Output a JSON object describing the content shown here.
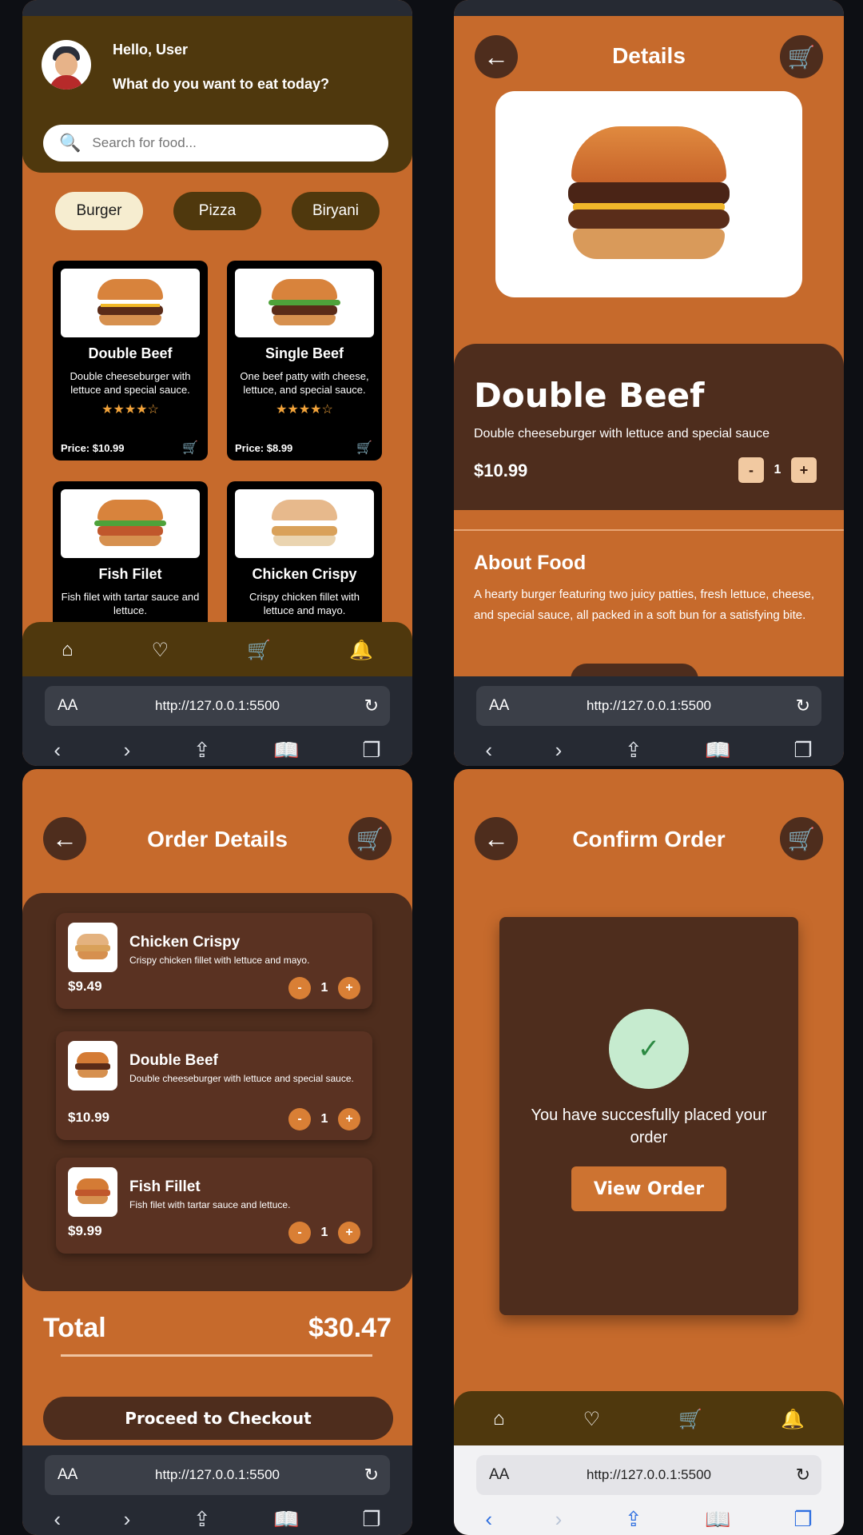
{
  "browser": {
    "aa": "AA",
    "url": "http://127.0.0.1:5500",
    "reload_icon": "↻"
  },
  "nav_icons": {
    "home": "⌂",
    "heart": "♡",
    "cart": "🛒",
    "bell": "🔔"
  },
  "browser_nav_icons": {
    "back": "‹",
    "forward": "›",
    "share": "⇪",
    "bookmarks": "📖",
    "tabs": "❐"
  },
  "screen1": {
    "greeting": "Hello, User",
    "question": "What do you want to eat today?",
    "search_placeholder": "Search for food...",
    "categories": [
      "Burger",
      "Pizza",
      "Biryani"
    ],
    "active_category": "Burger",
    "foods": [
      {
        "name": "Double Beef",
        "desc": "Double cheeseburger with lettuce and special sauce.",
        "stars": "★★★★☆",
        "price": "Price: $10.99"
      },
      {
        "name": "Single Beef",
        "desc": "One beef patty with cheese, lettuce, and special sauce.",
        "stars": "★★★★☆",
        "price": "Price: $8.99"
      },
      {
        "name": "Fish Filet",
        "desc": "Fish filet with tartar sauce and lettuce.",
        "stars": "",
        "price": ""
      },
      {
        "name": "Chicken Crispy",
        "desc": "Crispy chicken fillet with lettuce and mayo.",
        "stars": "",
        "price": ""
      }
    ]
  },
  "screen2": {
    "title": "Details",
    "food_name": "Double Beef",
    "food_desc": "Double cheeseburger with lettuce and special sauce",
    "price": "$10.99",
    "qty": "1",
    "minus": "-",
    "plus": "+",
    "about_title": "About Food",
    "about_text": "A hearty burger featuring two juicy patties, fresh lettuce, cheese, and special sauce, all packed in a soft bun for a satisfying bite."
  },
  "screen3": {
    "title": "Order Details",
    "items": [
      {
        "name": "Chicken Crispy",
        "desc": "Crispy chicken fillet with lettuce and mayo.",
        "price": "$9.49",
        "qty": "1"
      },
      {
        "name": "Double Beef",
        "desc": "Double cheeseburger with lettuce and special sauce.",
        "price": "$10.99",
        "qty": "1"
      },
      {
        "name": "Fish Fillet",
        "desc": "Fish filet with tartar sauce and lettuce.",
        "price": "$9.99",
        "qty": "1"
      }
    ],
    "total_label": "Total",
    "total_value": "$30.47",
    "checkout_label": "Proceed to Checkout"
  },
  "screen4": {
    "title": "Confirm Order",
    "check": "✓",
    "message": "You have succesfully placed your order",
    "view_order_label": "View Order"
  },
  "colors": {
    "page_orange": "#c66a2c",
    "dark_brown": "#4e2d1d",
    "nav_brown": "#4f380d",
    "accent_orange": "#d97f35"
  }
}
